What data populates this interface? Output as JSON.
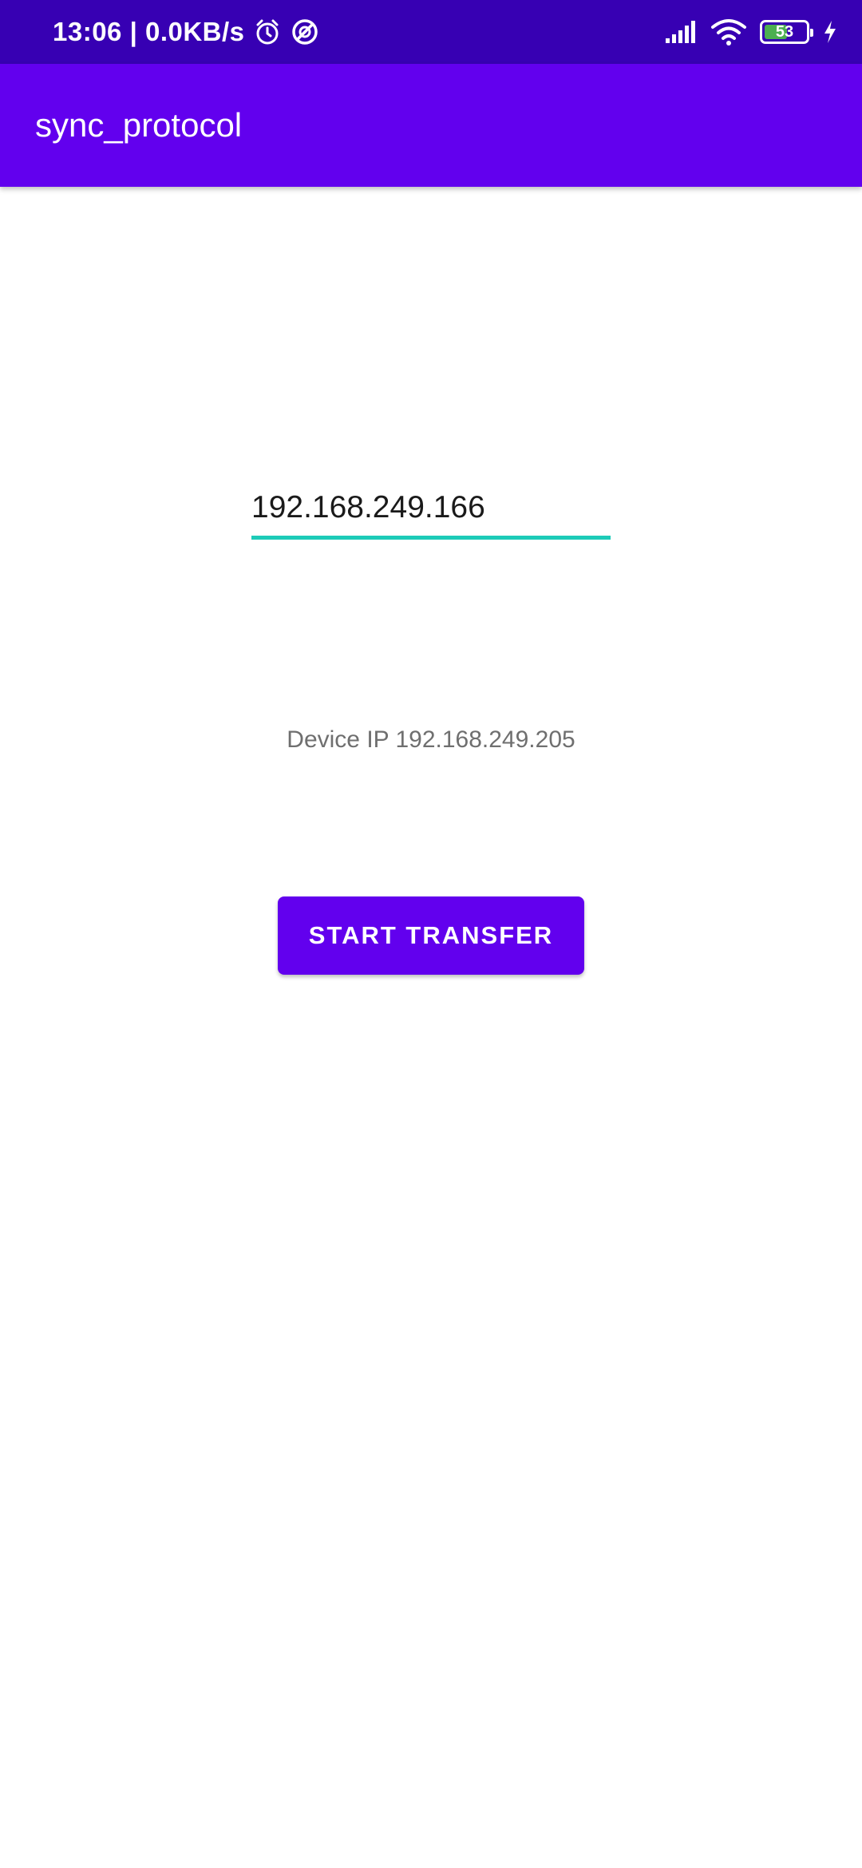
{
  "status_bar": {
    "time_speed": "13:06 | 0.0KB/s",
    "battery_level": "53",
    "icons": [
      "alarm-icon",
      "no-disturb-icon",
      "signal-icon",
      "wifi-icon",
      "battery-icon",
      "charging-icon"
    ],
    "background_color": "#3700B3"
  },
  "app_bar": {
    "title": "sync_protocol",
    "background_color": "#6200EE"
  },
  "ip_input": {
    "value": "192.168.249.166",
    "underline_color": "#1DCBB8"
  },
  "device_ip": {
    "text": "Device IP 192.168.249.205"
  },
  "start_button": {
    "label": "START TRANSFER",
    "background_color": "#6200EE"
  }
}
